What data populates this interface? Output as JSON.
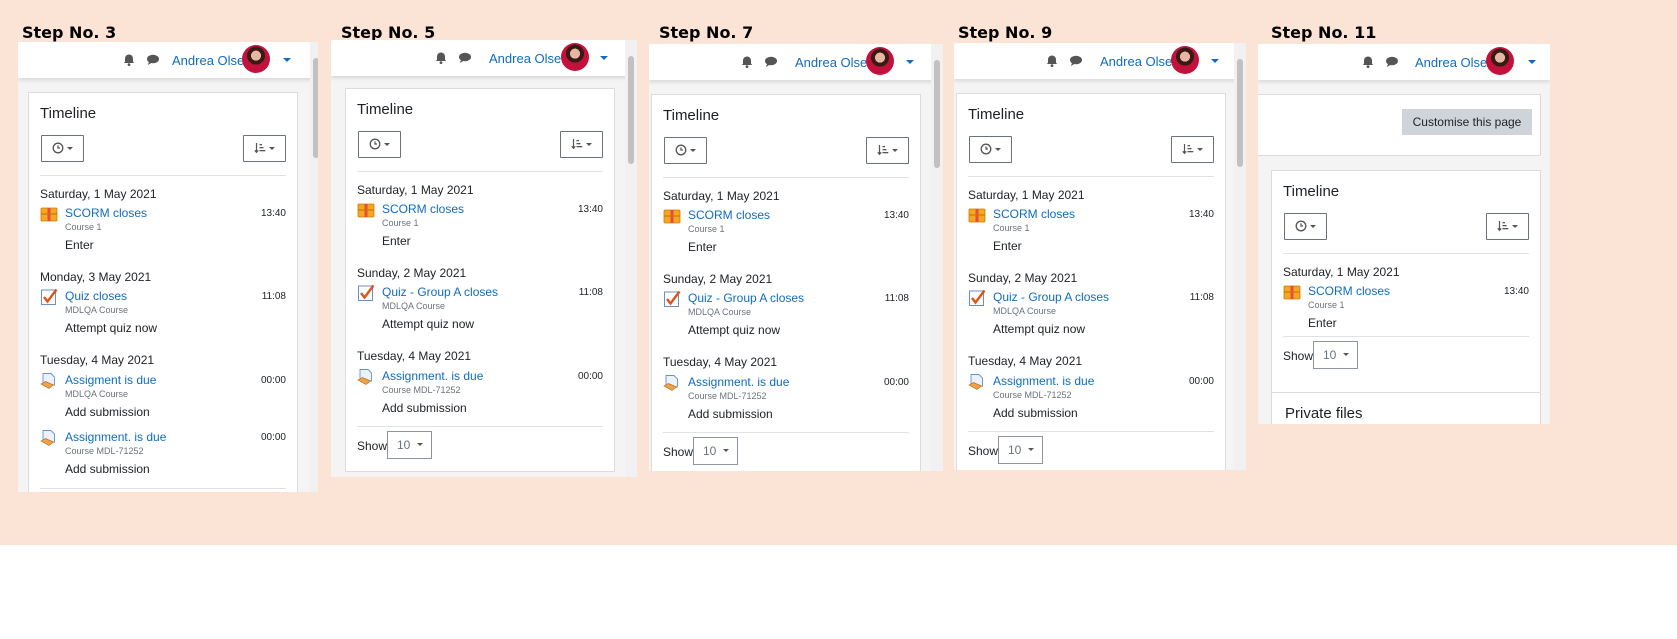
{
  "steps": [
    "Step No. 3",
    "Step No. 5",
    "Step No. 7",
    "Step No. 9",
    "Step No. 11"
  ],
  "user": {
    "name": "Andrea Olsen"
  },
  "timeline": {
    "title": "Timeline",
    "show_label": "Show",
    "show_value": "10",
    "date_sat1": "Saturday, 1 May 2021",
    "date_mon3": "Monday, 3 May 2021",
    "date_sun2": "Sunday, 2 May 2021",
    "date_tue4": "Tuesday, 4 May 2021",
    "scorm": {
      "name": "SCORM closes",
      "course": "Course 1",
      "time": "13:40",
      "action": "Enter"
    },
    "quiz": {
      "name": "Quiz closes",
      "course": "MDLQA Course",
      "time": "11:08",
      "action": "Attempt quiz now"
    },
    "quiz_group": {
      "name": "Quiz - Group A closes",
      "course": "MDLQA Course",
      "time": "11:08",
      "action": "Attempt quiz now"
    },
    "assign1": {
      "name": "Assigment is due",
      "course": "MDLQA Course",
      "time": "00:00",
      "action": "Add submission"
    },
    "assign2": {
      "name": "Assignment. is due",
      "course": "Course MDL-71252",
      "time": "00:00",
      "action": "Add submission"
    }
  },
  "customise_button": "Customise this page",
  "private_files": "Private files",
  "icons": [
    "bell-icon",
    "chat-icon",
    "clock-icon",
    "sort-icon",
    "scorm-icon",
    "quiz-icon",
    "assignment-icon",
    "chevron-down-icon"
  ],
  "colors": {
    "background": "#fbe4d5",
    "link": "#0f6cbf",
    "text": "#1d2125"
  }
}
